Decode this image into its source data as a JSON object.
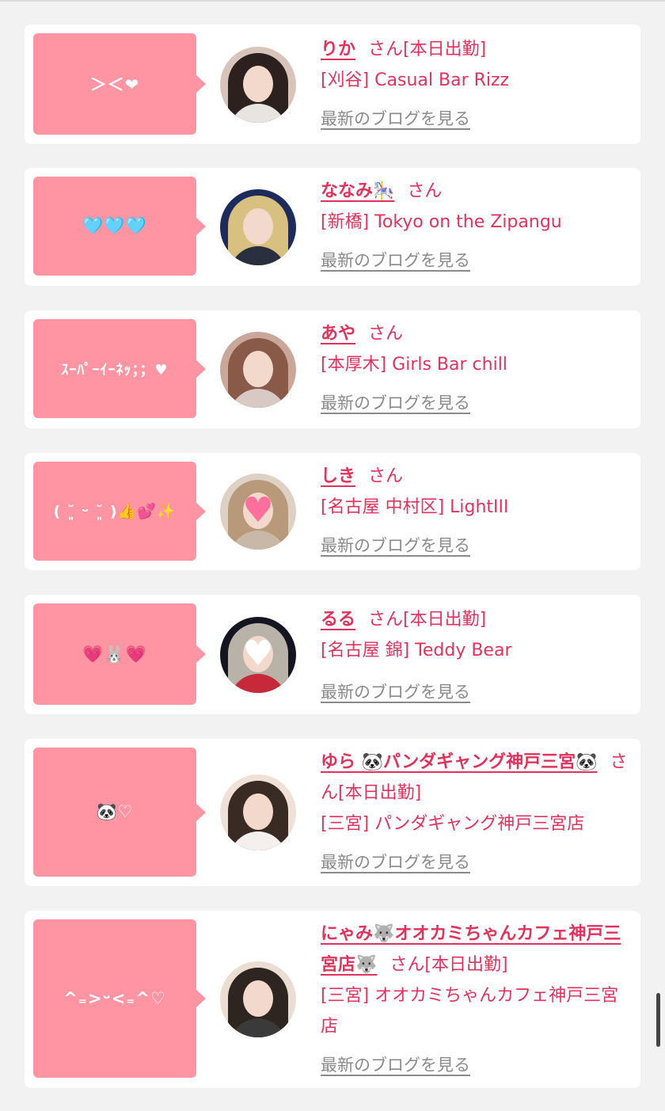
{
  "girls": [
    {
      "bubble": "＞＜❤",
      "name": "りか",
      "honorific": "さん[本日出勤]",
      "shop": "[刈谷] Casual Bar Rizz",
      "blog_link": "最新のブログを見る"
    },
    {
      "bubble": "🩵🩵🩵",
      "name": "ななみ🎠",
      "honorific": "さん",
      "shop": "[新橋] Tokyo on the Zipangu",
      "blog_link": "最新のブログを見る"
    },
    {
      "bubble": "ｽｰﾊﾟｰｲｰﾈｯ；；♥",
      "name": "あや",
      "honorific": "さん",
      "shop": "[本厚木] Girls Bar chill",
      "blog_link": "最新のブログを見る"
    },
    {
      "bubble": "( ˘͈ ᵕ ˘͈ )👍💕✨",
      "name": "しき",
      "honorific": "さん",
      "shop": "[名古屋 中村区] LightIII",
      "blog_link": "最新のブログを見る"
    },
    {
      "bubble": "💗🐰💗",
      "name": "るる",
      "honorific": "さん[本日出勤]",
      "shop": "[名古屋 錦] Teddy Bear",
      "blog_link": "最新のブログを見る"
    },
    {
      "bubble": "🐼♡",
      "name": "ゆら 🐼パンダギャング神戸三宮🐼",
      "honorific": "さん[本日出勤]",
      "shop": "[三宮] パンダギャング神戸三宮店",
      "blog_link": "最新のブログを見る"
    },
    {
      "bubble": "^₌>ᵕ<₌^♡",
      "name": "にゃみ🐺オオカミちゃんカフェ神戸三宮店🐺",
      "honorific": "さん[本日出勤]",
      "shop": "[三宮] オオカミちゃんカフェ神戸三宮店",
      "blog_link": "最新のブログを見る"
    }
  ],
  "colors": {
    "accent": "#e0335c",
    "bubble": "#ff94a3",
    "background": "#f2f2f2",
    "link_gray": "#8a8a8a"
  }
}
